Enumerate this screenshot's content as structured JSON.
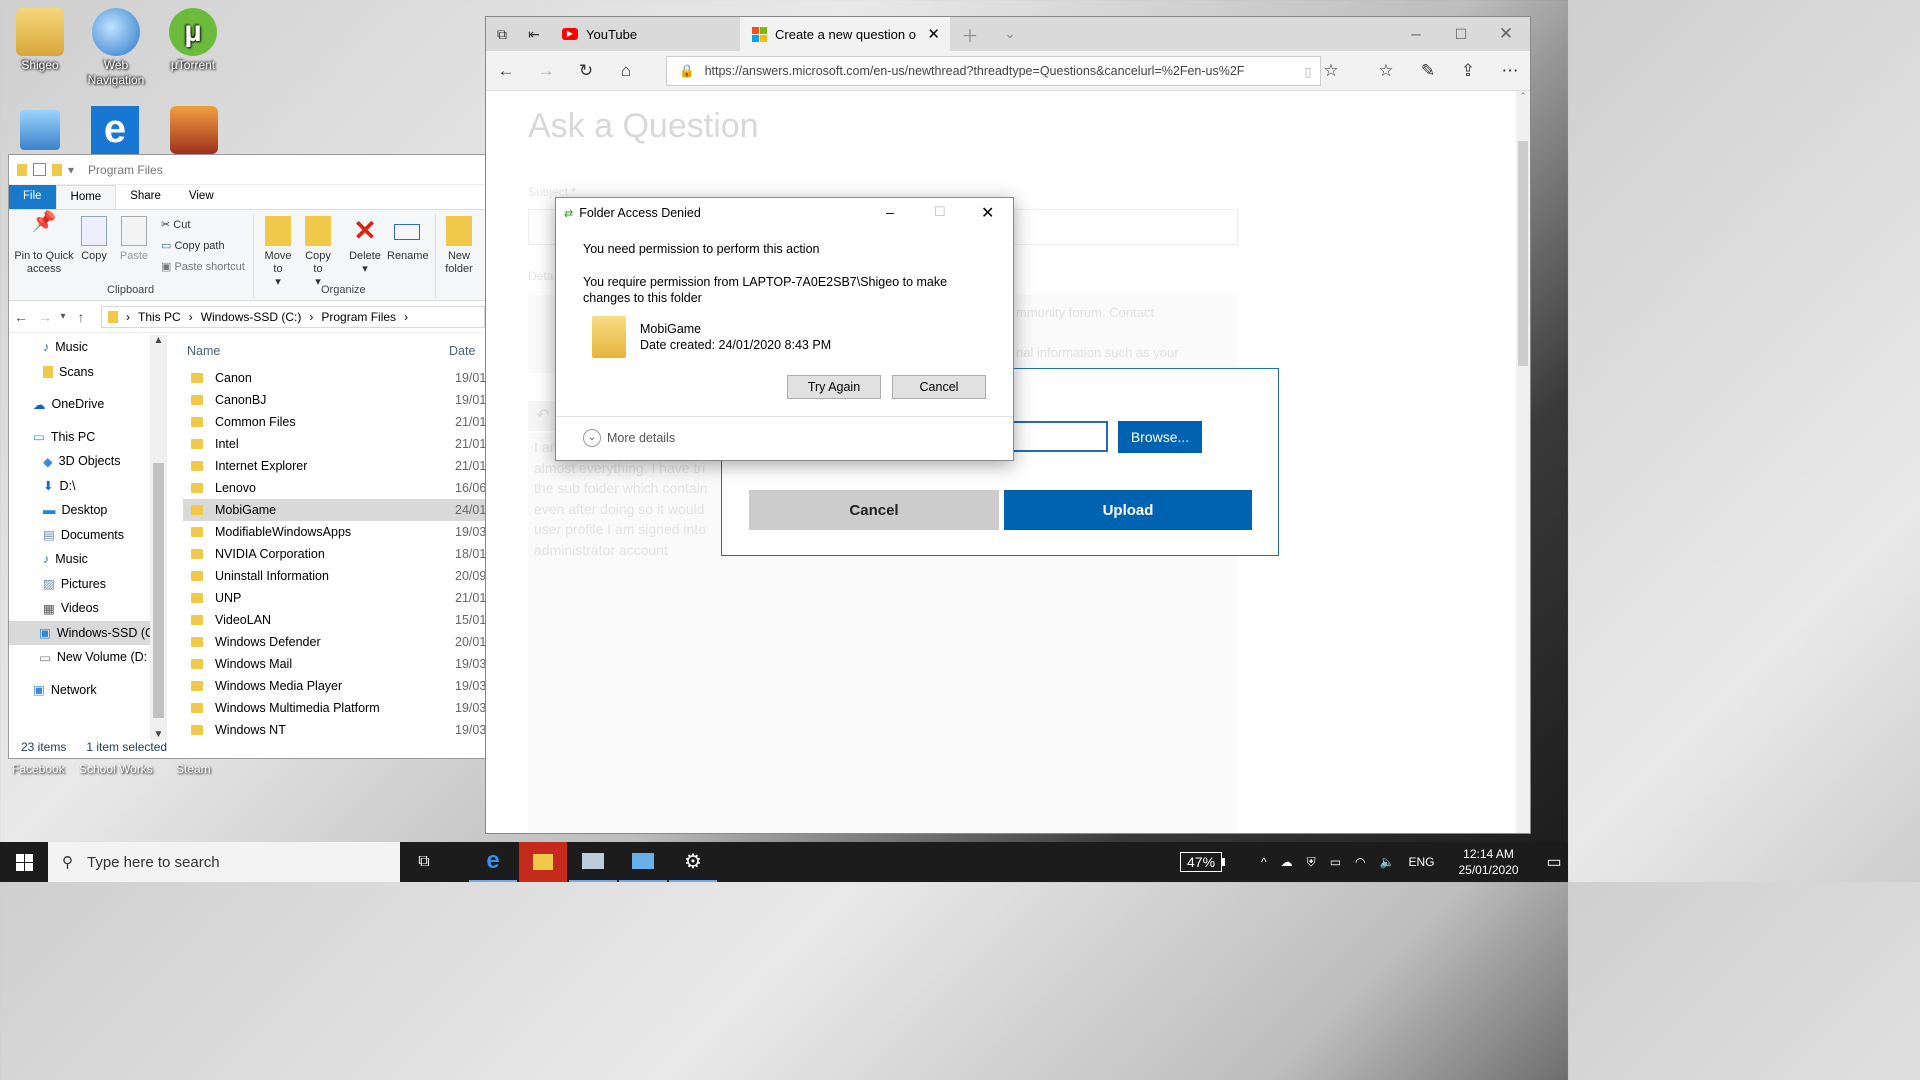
{
  "desktop": {
    "icons": [
      {
        "label": "Shigeo"
      },
      {
        "label": "Web Navigation"
      },
      {
        "label": "µTorrent"
      }
    ],
    "bottom_labels": [
      "Facebook",
      "School Works",
      "Steam"
    ]
  },
  "explorer": {
    "title": "Program Files",
    "tabs": [
      "File",
      "Home",
      "Share",
      "View"
    ],
    "ribbon": {
      "pin": "Pin to Quick access",
      "copy": "Copy",
      "paste": "Paste",
      "cut": "Cut",
      "copy_path": "Copy path",
      "paste_shortcut": "Paste shortcut",
      "clipboard": "Clipboard",
      "move_to": "Move to",
      "copy_to": "Copy to",
      "delete": "Delete",
      "rename": "Rename",
      "organize": "Organize",
      "new_folder": "New folder"
    },
    "breadcrumb": [
      "This PC",
      "Windows-SSD (C:)",
      "Program Files"
    ],
    "nav": [
      "Music",
      "Scans",
      "OneDrive",
      "This PC",
      "3D Objects",
      "D:\\",
      "Desktop",
      "Documents",
      "Music",
      "Pictures",
      "Videos",
      "Windows-SSD (C",
      "New Volume (D:",
      "Network"
    ],
    "columns": {
      "name": "Name",
      "date": "Date"
    },
    "files": [
      {
        "name": "Canon",
        "date": "19/01"
      },
      {
        "name": "CanonBJ",
        "date": "19/01"
      },
      {
        "name": "Common Files",
        "date": "21/01"
      },
      {
        "name": "Intel",
        "date": "21/01"
      },
      {
        "name": "Internet Explorer",
        "date": "21/01"
      },
      {
        "name": "Lenovo",
        "date": "16/06"
      },
      {
        "name": "MobiGame",
        "date": "24/01"
      },
      {
        "name": "ModifiableWindowsApps",
        "date": "19/03"
      },
      {
        "name": "NVIDIA Corporation",
        "date": "18/01"
      },
      {
        "name": "Uninstall Information",
        "date": "20/09"
      },
      {
        "name": "UNP",
        "date": "21/01"
      },
      {
        "name": "VideoLAN",
        "date": "15/01"
      },
      {
        "name": "Windows Defender",
        "date": "20/01"
      },
      {
        "name": "Windows Mail",
        "date": "19/03"
      },
      {
        "name": "Windows Media Player",
        "date": "19/03"
      },
      {
        "name": "Windows Multimedia Platform",
        "date": "19/03"
      },
      {
        "name": "Windows NT",
        "date": "19/03"
      }
    ],
    "status_items": "23 items",
    "status_selected": "1 item selected"
  },
  "browser": {
    "tabs": [
      {
        "title": "YouTube"
      },
      {
        "title": "Create a new question o"
      }
    ],
    "url": "https://answers.microsoft.com/en-us/newthread?threadtype=Questions&cancelurl=%2Fen-us%2F",
    "page": {
      "heading": "Ask a Question",
      "subject_label": "Subject *",
      "details_label": "Deta",
      "faded_1": "mmunity forum. Contact",
      "faded_2": "nal information such as your",
      "body_lines": [
        "I an",
        "almost everything. I have tri",
        "the sub folder which contain",
        "even after doing so it would",
        "user profile I am signed into",
        "administrator account"
      ]
    },
    "upload": {
      "browse": "Browse...",
      "cancel": "Cancel",
      "upload": "Upload"
    }
  },
  "dialog": {
    "title": "Folder Access Denied",
    "message": "You need permission to perform this action",
    "detail": "You require permission from LAPTOP-7A0E2SB7\\Shigeo to make changes to this folder",
    "folder_name": "MobiGame",
    "date_created": "Date created: 24/01/2020 8:43 PM",
    "try_again": "Try Again",
    "cancel": "Cancel",
    "more_details": "More details"
  },
  "taskbar": {
    "search_placeholder": "Type here to search",
    "battery": "47%",
    "lang": "ENG",
    "time": "12:14 AM",
    "date": "25/01/2020"
  },
  "colors": {
    "accent": "#0063b1",
    "explorer_file_tab": "#1979ca",
    "folder": "#f1c94a"
  }
}
